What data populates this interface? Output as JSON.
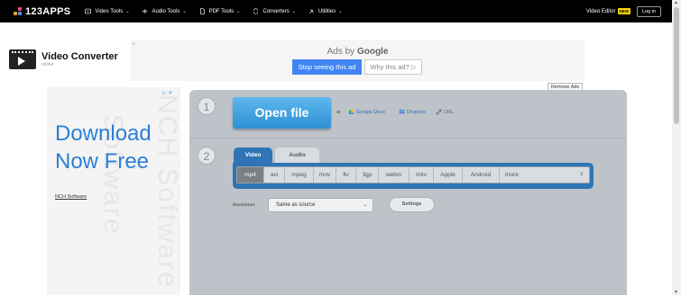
{
  "nav": {
    "logo": "123APPS",
    "items": [
      {
        "label": "Video Tools",
        "icon": "play-icon"
      },
      {
        "label": "Audio Tools",
        "icon": "audio-icon"
      },
      {
        "label": "PDF Tools",
        "icon": "document-icon"
      },
      {
        "label": "Converters",
        "icon": "convert-icon"
      },
      {
        "label": "Utilities",
        "icon": "tools-icon"
      }
    ],
    "video_editor": "Video Editor",
    "new_badge": "NEW",
    "login": "Log in"
  },
  "brand": {
    "title": "Video Converter",
    "subtitle": "online"
  },
  "ad_top": {
    "marker": "▹",
    "ads_by": "Ads by",
    "google": "Google",
    "stop": "Stop seeing this ad",
    "why": "Why this ad? ▷"
  },
  "remove_ads": "Remove Ads",
  "side_ad": {
    "choices": "▷ ✕",
    "headline_1": "Download",
    "headline_2": "Now Free",
    "advertiser": "NCH Software",
    "watermark_1": "Software",
    "watermark_2": "NCH Software"
  },
  "converter": {
    "step1": "1",
    "step2": "2",
    "open_file": "Open file",
    "or": "or",
    "sources": [
      {
        "label": "Google Drive",
        "icon": "google-drive-icon"
      },
      {
        "label": "Dropbox",
        "icon": "dropbox-icon"
      },
      {
        "label": "URL",
        "icon": "link-icon"
      }
    ],
    "tabs": {
      "video": "Video",
      "audio": "Audio"
    },
    "formats": [
      "mp4",
      "avi",
      "mpeg",
      "mov",
      "flv",
      "3gp",
      "webm",
      "mkv",
      "Apple",
      "Android"
    ],
    "format_widths": [
      30,
      23,
      32,
      25,
      22,
      25,
      34,
      27,
      32,
      41
    ],
    "selected_format": "mp4",
    "more": "more",
    "resolution_label": "Resolution:",
    "resolution_value": "Same as source",
    "settings": "Settings"
  },
  "colors": {
    "accent": "#2f74b5",
    "open_button": "#3a9ce0",
    "panel": "#bdc3c9",
    "ad_text": "#2b7fd6"
  }
}
